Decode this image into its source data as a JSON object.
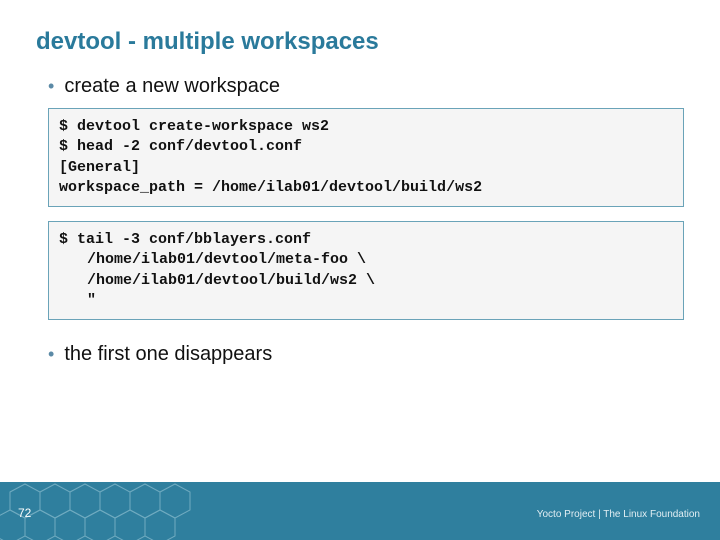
{
  "title": "devtool - multiple workspaces",
  "bullet1": "create a new workspace",
  "code1": {
    "l1": "$ devtool create-workspace ws2",
    "l2": "$ head -2 conf/devtool.conf",
    "l3": "[General]",
    "l4": "workspace_path = /home/ilab01/devtool/build/ws2"
  },
  "code2": {
    "l1": "$ tail -3 conf/bblayers.conf",
    "l2": "/home/ilab01/devtool/meta-foo \\",
    "l3": "/home/ilab01/devtool/build/ws2 \\",
    "l4": "\""
  },
  "bullet2": "the first one disappears",
  "footer": {
    "page": "72",
    "right": "Yocto Project | The Linux Foundation"
  }
}
